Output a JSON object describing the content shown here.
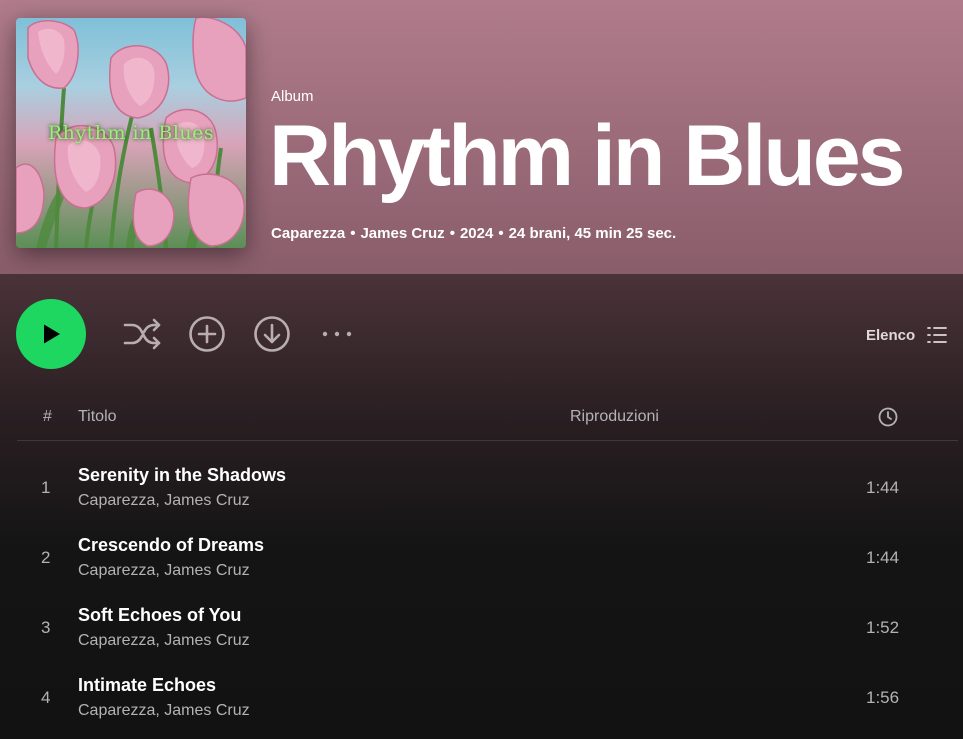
{
  "album": {
    "type_label": "Album",
    "title": "Rhythm in Blues",
    "cover_text": "Rhythm in Blues",
    "meta": {
      "artist1": "Caparezza",
      "artist2": "James Cruz",
      "year": "2024",
      "tracks_duration": "24 brani, 45 min 25 sec."
    }
  },
  "controls": {
    "view_label": "Elenco",
    "icons": [
      "play-icon",
      "shuffle-icon",
      "add-circle-icon",
      "download-icon",
      "more-options-icon",
      "list-view-icon"
    ]
  },
  "table": {
    "header": {
      "num": "#",
      "title": "Titolo",
      "plays": "Riproduzioni",
      "duration_icon": "clock-icon"
    },
    "rows": [
      {
        "num": "1",
        "title": "Serenity in the Shadows",
        "artists": "Caparezza, James Cruz",
        "duration": "1:44"
      },
      {
        "num": "2",
        "title": "Crescendo of Dreams",
        "artists": "Caparezza, James Cruz",
        "duration": "1:44"
      },
      {
        "num": "3",
        "title": "Soft Echoes of You",
        "artists": "Caparezza, James Cruz",
        "duration": "1:52"
      },
      {
        "num": "4",
        "title": "Intimate Echoes",
        "artists": "Caparezza, James Cruz",
        "duration": "1:56"
      }
    ]
  },
  "colors": {
    "accent": "#1ed760",
    "hero": "#b07c8c",
    "background": "#121212",
    "muted_text": "#b3b3b3"
  }
}
